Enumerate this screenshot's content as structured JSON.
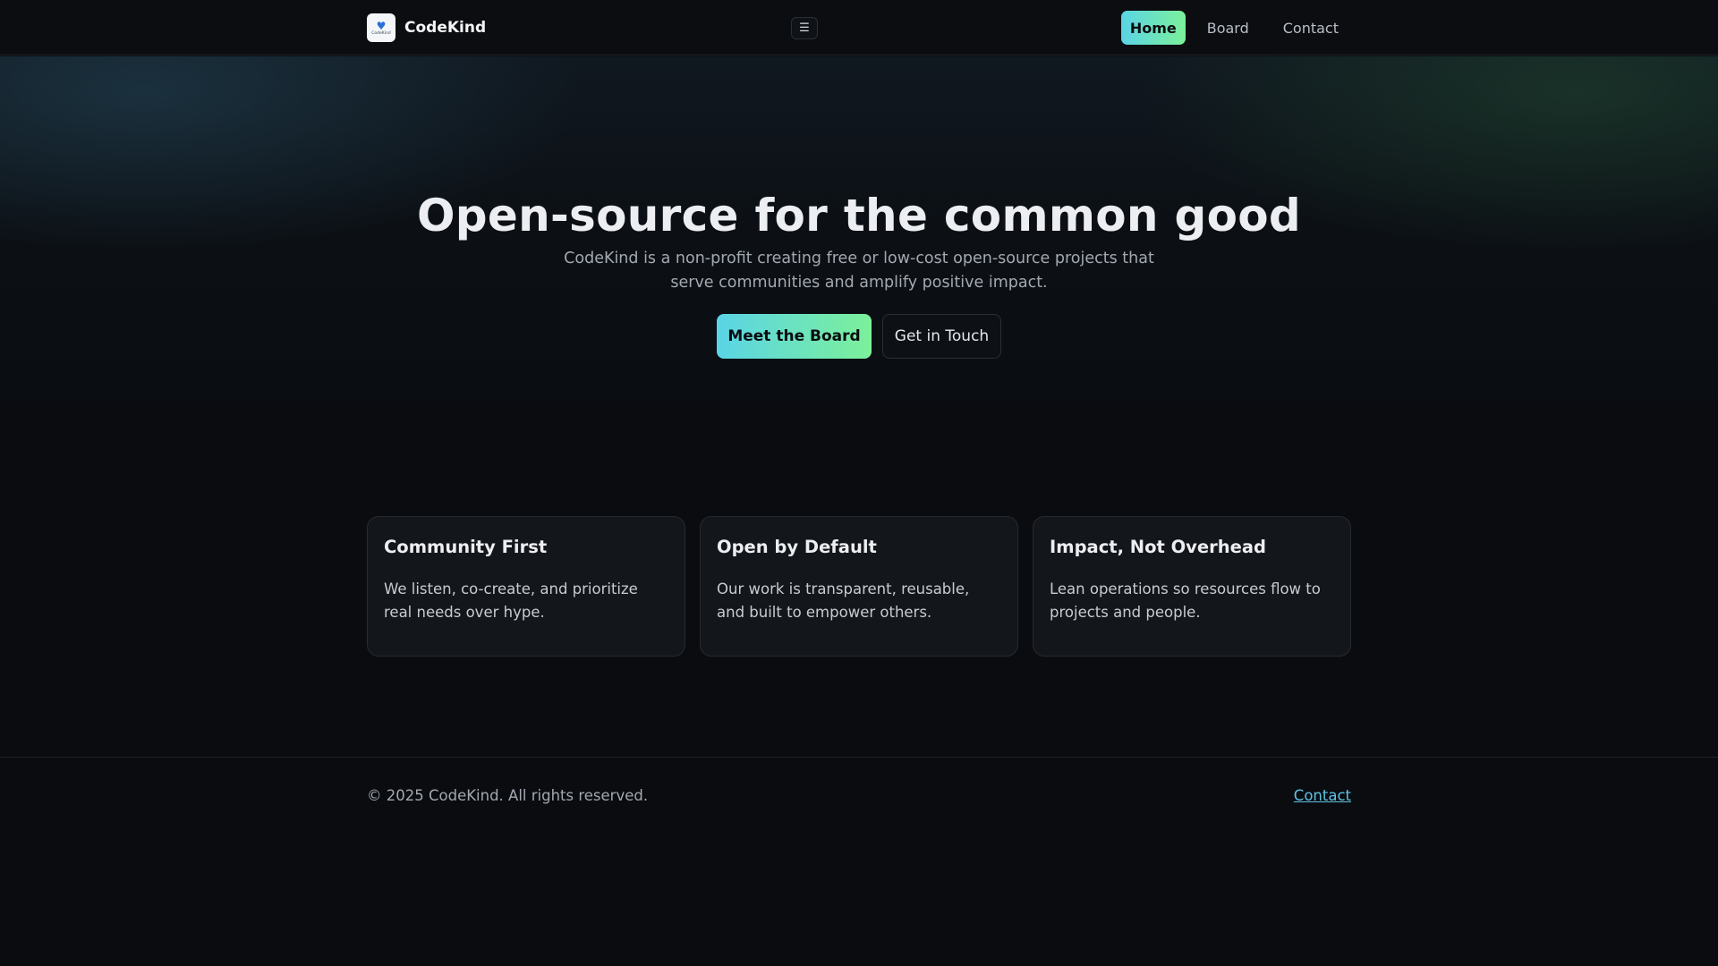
{
  "header": {
    "brand_name": "CodeKind",
    "logo_text": "CodeKind",
    "menu_toggle": "☰",
    "nav": [
      {
        "label": "Home",
        "active": true
      },
      {
        "label": "Board",
        "active": false
      },
      {
        "label": "Contact",
        "active": false
      }
    ]
  },
  "hero": {
    "title": "Open-source for the common good",
    "subtitle": "CodeKind is a non-profit creating free or low-cost open-source projects that serve communities and amplify positive impact.",
    "primary_button": "Meet the Board",
    "secondary_button": "Get in Touch"
  },
  "cards": [
    {
      "title": "Community First",
      "text": "We listen, co-create, and prioritize real needs over hype."
    },
    {
      "title": "Open by Default",
      "text": "Our work is transparent, reusable, and built to empower others."
    },
    {
      "title": "Impact, Not Overhead",
      "text": "Lean operations so resources flow to projects and people."
    }
  ],
  "footer": {
    "copyright": "© 2025 CodeKind. All rights reserved.",
    "link": "Contact"
  },
  "colors": {
    "background": "#0a0c10",
    "accent_gradient_start": "#5ad4e6",
    "accent_gradient_end": "#7cf09a",
    "link": "#5fc3e4"
  }
}
